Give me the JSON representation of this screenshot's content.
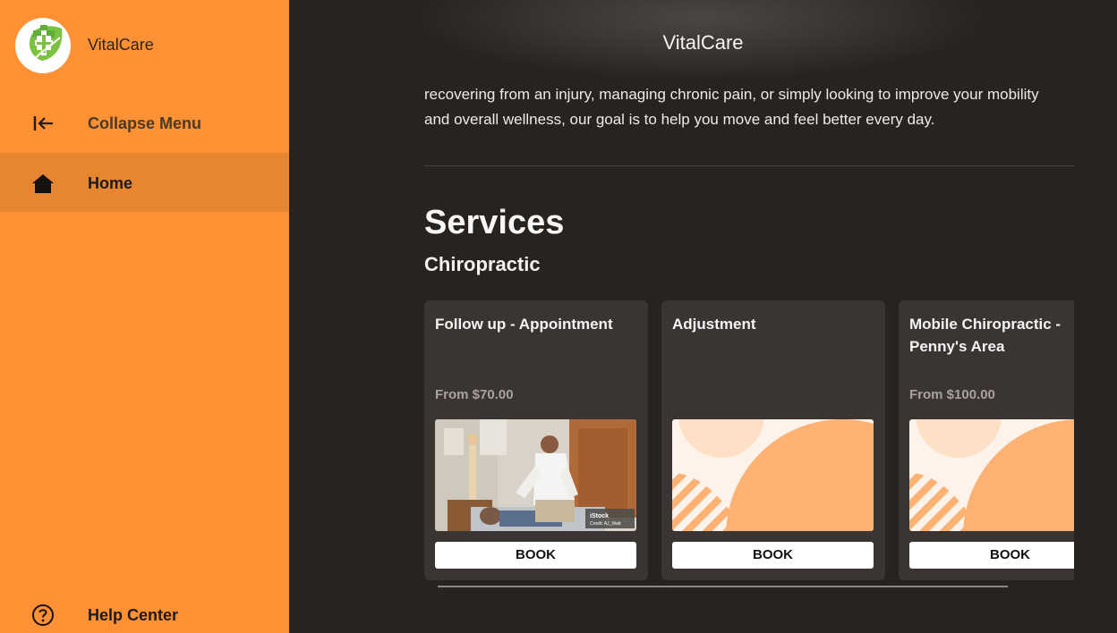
{
  "app": {
    "name": "VitalCare"
  },
  "sidebar": {
    "brand_name": "VitalCare",
    "items": [
      {
        "label": "Collapse Menu",
        "icon": "collapse-left-icon"
      },
      {
        "label": "Home",
        "icon": "home-icon",
        "active": true
      },
      {
        "label": "Help Center",
        "icon": "help-circle-icon"
      }
    ],
    "accent_color": "#fd9133"
  },
  "header": {
    "title": "VitalCare"
  },
  "main": {
    "intro_text": "recovering from an injury, managing chronic pain, or simply looking to improve your mobility and overall wellness, our goal is to help you move and feel better every day.",
    "services_title": "Services",
    "category": "Chiropractic",
    "cards": [
      {
        "title": "Follow up - Appointment",
        "price": "From $70.00",
        "image": "chiropractor-photo",
        "button": "BOOK"
      },
      {
        "title": "Adjustment",
        "price": "",
        "image": "orange-pattern-placeholder",
        "button": "BOOK"
      },
      {
        "title": "Mobile Chiropractic - Penny's Area",
        "price": "From $100.00",
        "image": "orange-pattern-placeholder",
        "button": "BOOK"
      }
    ],
    "photo_credit": {
      "brand": "iStock",
      "credit": "Credit: AJ_Watt"
    }
  }
}
